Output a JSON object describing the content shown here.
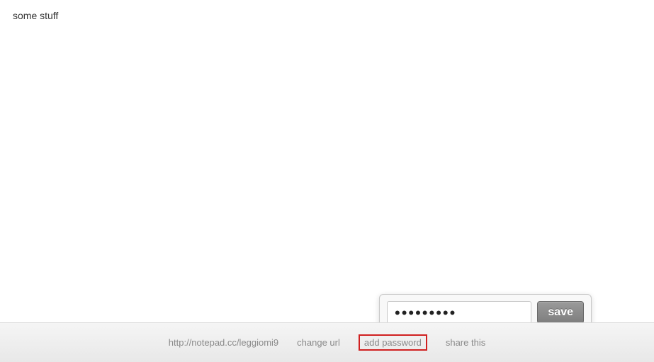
{
  "editor": {
    "content": "some stuff"
  },
  "footer": {
    "url": "http://notepad.cc/leggiomi9",
    "change_url_label": "change url",
    "add_password_label": "add password",
    "share_this_label": "share this"
  },
  "popover": {
    "password_value": "•••••••••",
    "save_label": "save"
  }
}
